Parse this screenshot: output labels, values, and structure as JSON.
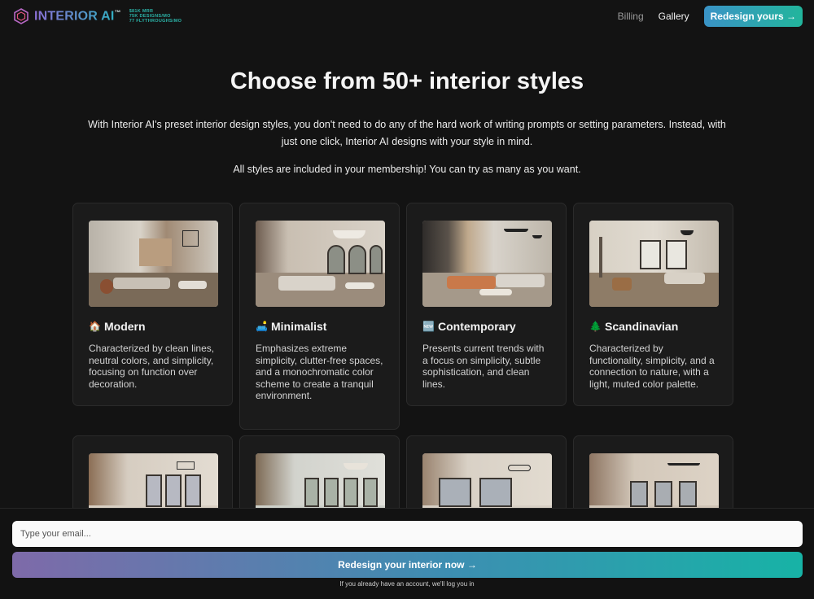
{
  "header": {
    "logo_text": "INTERIOR AI",
    "logo_tm": "™",
    "stats": [
      "$81K MRR",
      "75K DESIGNS/MO",
      "77 FLYTHROUGHS/MO"
    ],
    "nav": [
      {
        "label": "Billing",
        "active": false
      },
      {
        "label": "Gallery",
        "active": true
      }
    ],
    "cta_label": "Redesign yours →"
  },
  "hero": {
    "title": "Choose from 50+ interior styles",
    "description": "With Interior AI's preset interior design styles, you don't need to do any of the hard work of writing prompts or setting parameters. Instead, with just one click, Interior AI designs with your style in mind.",
    "note": "All styles are included in your membership! You can try as many as you want."
  },
  "styles": [
    {
      "emoji": "🏠",
      "title": "Modern",
      "description": "Characterized by clean lines, neutral colors, and simplicity, focusing on function over decoration."
    },
    {
      "emoji": "🛋️",
      "title": "Minimalist",
      "description": "Emphasizes extreme simplicity, clutter-free spaces, and a monochromatic color scheme to create a tranquil environment."
    },
    {
      "emoji": "🆕",
      "title": "Contemporary",
      "description": "Presents current trends with a focus on simplicity, subtle sophistication, and clean lines."
    },
    {
      "emoji": "🌲",
      "title": "Scandinavian",
      "description": "Characterized by functionality, simplicity, and a connection to nature, with a light, muted color palette."
    }
  ],
  "footer": {
    "email_placeholder": "Type your email...",
    "cta_label": "Redesign your interior now →",
    "note": "If you already have an account, we'll log you in"
  },
  "colors": {
    "background": "#131313",
    "card": "#1b1b1b",
    "accent_start": "#7e6aa9",
    "accent_end": "#17b3a6"
  }
}
